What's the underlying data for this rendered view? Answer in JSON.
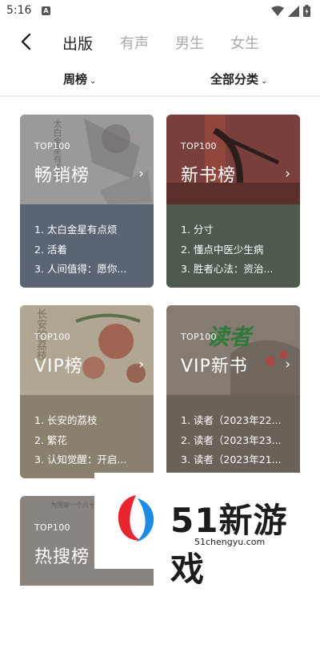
{
  "status": {
    "time": "5:16",
    "notif_glyph": "A"
  },
  "tabs": [
    {
      "label": "出版",
      "active": true
    },
    {
      "label": "有声",
      "active": false
    },
    {
      "label": "男生",
      "active": false
    },
    {
      "label": "女生",
      "active": false
    }
  ],
  "filters": {
    "period": "周榜",
    "category": "全部分类"
  },
  "cards": [
    {
      "top": "TOP100",
      "title": "畅销榜",
      "items": [
        "1. 太白金星有点烦",
        "2. 活着",
        "3. 人间值得：愿你..."
      ],
      "top_color": "#8a8a8a",
      "bottom_color": "#5a6472"
    },
    {
      "top": "TOP100",
      "title": "新书榜",
      "items": [
        "1. 分寸",
        "2. 懂点中医少生病",
        "3. 胜者心法：资治..."
      ],
      "top_color": "#6e3a36",
      "bottom_color": "#4f5a4e"
    },
    {
      "top": "TOP100",
      "title": "VIP榜",
      "items": [
        "1. 长安的荔枝",
        "2. 繁花",
        "3. 认知觉醒：开启..."
      ],
      "top_color": "#a49986",
      "bottom_color": "#8a806f"
    },
    {
      "top": "TOP100",
      "title": "VIP新书",
      "items": [
        "1. 读者（2023年22...",
        "2. 读者（2023年23...",
        "3. 读者（2023年21..."
      ],
      "top_color": "#7a716a",
      "bottom_color": "#6a6258"
    },
    {
      "top": "TOP100",
      "title": "热搜榜",
      "items": [],
      "top_color": "#8a8480",
      "bottom_color": "#6f6a66"
    }
  ],
  "cover_text": {
    "card1": "太白金星有点烦",
    "card3": "长安的荔枝",
    "card4": "读者",
    "card5": "为国家一个八十"
  },
  "watermark": {
    "brand": "51新游戏",
    "url": "51chengyu.com"
  }
}
